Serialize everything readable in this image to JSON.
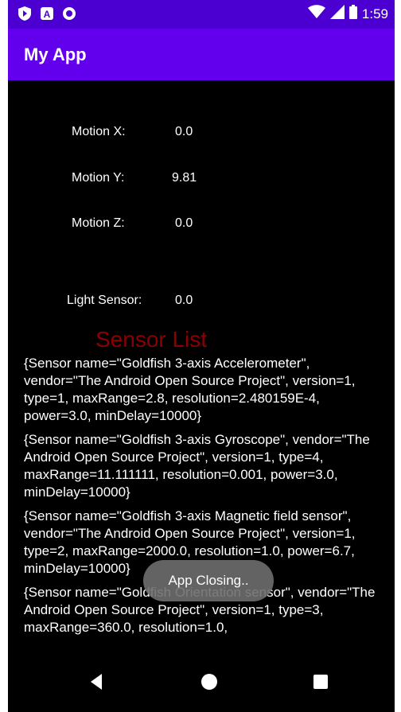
{
  "status_bar": {
    "time": "1:59",
    "icons": [
      "play-protect-icon",
      "a-icon",
      "circle-icon",
      "wifi-icon",
      "signal-icon",
      "battery-icon"
    ]
  },
  "app_bar": {
    "title": "My App"
  },
  "motion": {
    "x_label": "Motion X:",
    "x_value": "0.0",
    "y_label": "Motion Y:",
    "y_value": "9.81",
    "z_label": "Motion Z:",
    "z_value": "0.0"
  },
  "light": {
    "label": "Light Sensor:",
    "value": "0.0"
  },
  "sensor_list": {
    "title": "Sensor List",
    "items": [
      "{Sensor name=\"Goldfish 3-axis Accelerometer\", vendor=\"The Android Open Source Project\", version=1, type=1, maxRange=2.8, resolution=2.480159E-4, power=3.0, minDelay=10000}",
      "{Sensor name=\"Goldfish 3-axis Gyroscope\", vendor=\"The Android Open Source Project\", version=1, type=4, maxRange=11.111111, resolution=0.001, power=3.0, minDelay=10000}",
      "{Sensor name=\"Goldfish 3-axis Magnetic field sensor\", vendor=\"The Android Open Source Project\", version=1, type=2, maxRange=2000.0, resolution=1.0, power=6.7, minDelay=10000}",
      "{Sensor name=\"Goldfish Orientation sensor\", vendor=\"The Android Open Source Project\", version=1, type=3, maxRange=360.0, resolution=1.0,"
    ]
  },
  "toast": {
    "text": "App Closing.."
  },
  "colors": {
    "status_bar": "#4B00D1",
    "app_bar": "#6200EE",
    "section_title": "#8B0000"
  }
}
